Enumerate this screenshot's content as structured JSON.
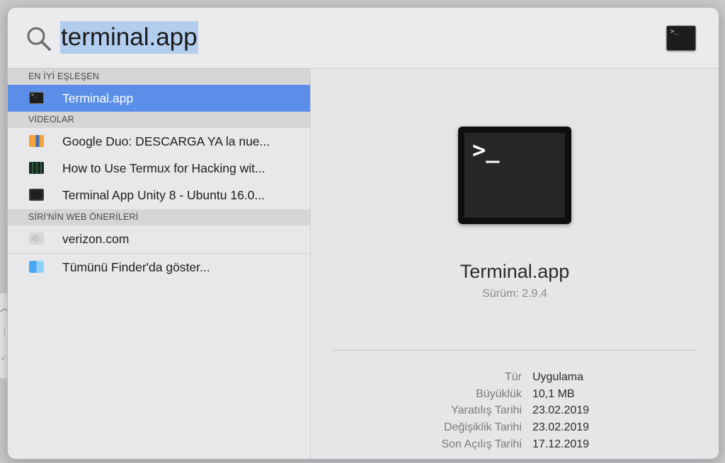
{
  "search": {
    "query": "terminal.app"
  },
  "sections": [
    {
      "header": "EN İYİ EŞLEŞEN",
      "items": [
        {
          "label": "Terminal.app",
          "icon": "terminal-icon",
          "selected": true
        }
      ]
    },
    {
      "header": "VİDEOLAR",
      "items": [
        {
          "label": "Google Duo: DESCARGA YA la nue...",
          "icon": "video-thumbnail-icon"
        },
        {
          "label": "How to Use Termux for Hacking wit...",
          "icon": "video-thumbnail-icon"
        },
        {
          "label": "Terminal App Unity 8 - Ubuntu 16.0...",
          "icon": "video-thumbnail-icon"
        }
      ]
    },
    {
      "header": "SİRİ'NİN WEB ÖNERİLERİ",
      "items": [
        {
          "label": "verizon.com",
          "icon": "web-globe-icon"
        }
      ]
    }
  ],
  "finder_row": {
    "label": "Tümünü Finder'da göster...",
    "icon": "finder-icon"
  },
  "preview": {
    "app_name": "Terminal.app",
    "version": "Sürüm: 2.9.4",
    "info": [
      {
        "key": "Tür",
        "value": "Uygulama"
      },
      {
        "key": "Büyüklük",
        "value": "10,1 MB"
      },
      {
        "key": "Yaratılış Tarihi",
        "value": "23.02.2019"
      },
      {
        "key": "Değişiklik Tarihi",
        "value": "23.02.2019"
      },
      {
        "key": "Son Açılış Tarihi",
        "value": "17.12.2019"
      }
    ]
  },
  "colors": {
    "selection": "#5b8ee8",
    "query_highlight": "#b3cdee"
  }
}
